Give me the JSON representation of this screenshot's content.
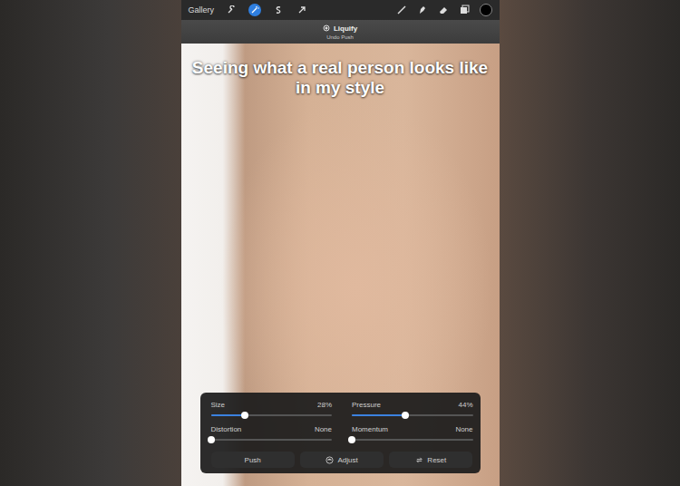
{
  "toolbar": {
    "gallery": "Gallery",
    "tools": [
      {
        "selected": false
      },
      {
        "selected": true
      },
      {
        "selected": false
      },
      {
        "selected": false
      }
    ],
    "current_color": "#000000"
  },
  "mode_bar": {
    "title": "Liquify",
    "subtitle": "Undo Push"
  },
  "caption": "Seeing what a real person looks like in my style",
  "panel": {
    "sliders": [
      {
        "label": "Size",
        "reading": "28%",
        "level": 0.28
      },
      {
        "label": "Pressure",
        "reading": "44%",
        "level": 0.44
      },
      {
        "label": "Distortion",
        "reading": "None",
        "level": 0
      },
      {
        "label": "Momentum",
        "reading": "None",
        "level": 0
      }
    ],
    "buttons": [
      "Push",
      "Adjust",
      "Reset"
    ]
  }
}
